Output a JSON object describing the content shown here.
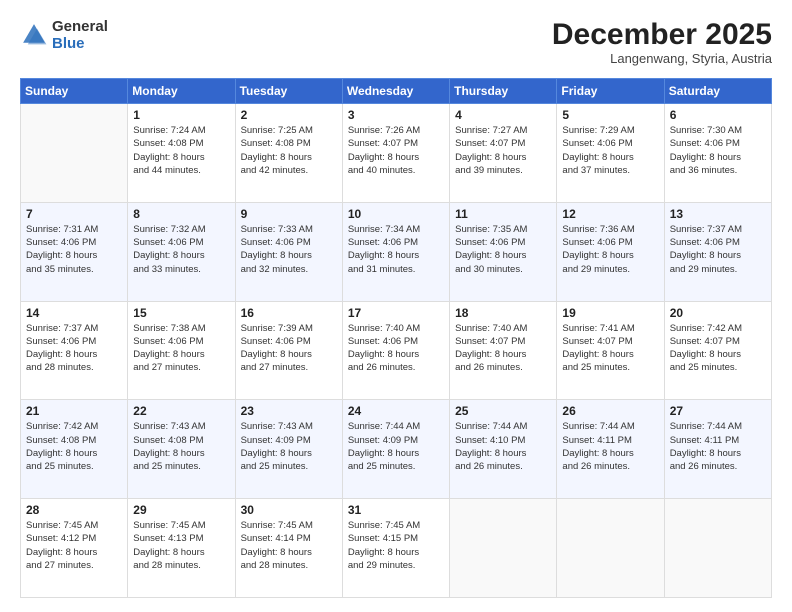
{
  "header": {
    "logo": {
      "general": "General",
      "blue": "Blue"
    },
    "title": "December 2025",
    "location": "Langenwang, Styria, Austria"
  },
  "calendar": {
    "weekdays": [
      "Sunday",
      "Monday",
      "Tuesday",
      "Wednesday",
      "Thursday",
      "Friday",
      "Saturday"
    ],
    "weeks": [
      [
        {
          "num": "",
          "info": ""
        },
        {
          "num": "1",
          "info": "Sunrise: 7:24 AM\nSunset: 4:08 PM\nDaylight: 8 hours\nand 44 minutes."
        },
        {
          "num": "2",
          "info": "Sunrise: 7:25 AM\nSunset: 4:08 PM\nDaylight: 8 hours\nand 42 minutes."
        },
        {
          "num": "3",
          "info": "Sunrise: 7:26 AM\nSunset: 4:07 PM\nDaylight: 8 hours\nand 40 minutes."
        },
        {
          "num": "4",
          "info": "Sunrise: 7:27 AM\nSunset: 4:07 PM\nDaylight: 8 hours\nand 39 minutes."
        },
        {
          "num": "5",
          "info": "Sunrise: 7:29 AM\nSunset: 4:06 PM\nDaylight: 8 hours\nand 37 minutes."
        },
        {
          "num": "6",
          "info": "Sunrise: 7:30 AM\nSunset: 4:06 PM\nDaylight: 8 hours\nand 36 minutes."
        }
      ],
      [
        {
          "num": "7",
          "info": "Sunrise: 7:31 AM\nSunset: 4:06 PM\nDaylight: 8 hours\nand 35 minutes."
        },
        {
          "num": "8",
          "info": "Sunrise: 7:32 AM\nSunset: 4:06 PM\nDaylight: 8 hours\nand 33 minutes."
        },
        {
          "num": "9",
          "info": "Sunrise: 7:33 AM\nSunset: 4:06 PM\nDaylight: 8 hours\nand 32 minutes."
        },
        {
          "num": "10",
          "info": "Sunrise: 7:34 AM\nSunset: 4:06 PM\nDaylight: 8 hours\nand 31 minutes."
        },
        {
          "num": "11",
          "info": "Sunrise: 7:35 AM\nSunset: 4:06 PM\nDaylight: 8 hours\nand 30 minutes."
        },
        {
          "num": "12",
          "info": "Sunrise: 7:36 AM\nSunset: 4:06 PM\nDaylight: 8 hours\nand 29 minutes."
        },
        {
          "num": "13",
          "info": "Sunrise: 7:37 AM\nSunset: 4:06 PM\nDaylight: 8 hours\nand 29 minutes."
        }
      ],
      [
        {
          "num": "14",
          "info": "Sunrise: 7:37 AM\nSunset: 4:06 PM\nDaylight: 8 hours\nand 28 minutes."
        },
        {
          "num": "15",
          "info": "Sunrise: 7:38 AM\nSunset: 4:06 PM\nDaylight: 8 hours\nand 27 minutes."
        },
        {
          "num": "16",
          "info": "Sunrise: 7:39 AM\nSunset: 4:06 PM\nDaylight: 8 hours\nand 27 minutes."
        },
        {
          "num": "17",
          "info": "Sunrise: 7:40 AM\nSunset: 4:06 PM\nDaylight: 8 hours\nand 26 minutes."
        },
        {
          "num": "18",
          "info": "Sunrise: 7:40 AM\nSunset: 4:07 PM\nDaylight: 8 hours\nand 26 minutes."
        },
        {
          "num": "19",
          "info": "Sunrise: 7:41 AM\nSunset: 4:07 PM\nDaylight: 8 hours\nand 25 minutes."
        },
        {
          "num": "20",
          "info": "Sunrise: 7:42 AM\nSunset: 4:07 PM\nDaylight: 8 hours\nand 25 minutes."
        }
      ],
      [
        {
          "num": "21",
          "info": "Sunrise: 7:42 AM\nSunset: 4:08 PM\nDaylight: 8 hours\nand 25 minutes."
        },
        {
          "num": "22",
          "info": "Sunrise: 7:43 AM\nSunset: 4:08 PM\nDaylight: 8 hours\nand 25 minutes."
        },
        {
          "num": "23",
          "info": "Sunrise: 7:43 AM\nSunset: 4:09 PM\nDaylight: 8 hours\nand 25 minutes."
        },
        {
          "num": "24",
          "info": "Sunrise: 7:44 AM\nSunset: 4:09 PM\nDaylight: 8 hours\nand 25 minutes."
        },
        {
          "num": "25",
          "info": "Sunrise: 7:44 AM\nSunset: 4:10 PM\nDaylight: 8 hours\nand 26 minutes."
        },
        {
          "num": "26",
          "info": "Sunrise: 7:44 AM\nSunset: 4:11 PM\nDaylight: 8 hours\nand 26 minutes."
        },
        {
          "num": "27",
          "info": "Sunrise: 7:44 AM\nSunset: 4:11 PM\nDaylight: 8 hours\nand 26 minutes."
        }
      ],
      [
        {
          "num": "28",
          "info": "Sunrise: 7:45 AM\nSunset: 4:12 PM\nDaylight: 8 hours\nand 27 minutes."
        },
        {
          "num": "29",
          "info": "Sunrise: 7:45 AM\nSunset: 4:13 PM\nDaylight: 8 hours\nand 28 minutes."
        },
        {
          "num": "30",
          "info": "Sunrise: 7:45 AM\nSunset: 4:14 PM\nDaylight: 8 hours\nand 28 minutes."
        },
        {
          "num": "31",
          "info": "Sunrise: 7:45 AM\nSunset: 4:15 PM\nDaylight: 8 hours\nand 29 minutes."
        },
        {
          "num": "",
          "info": ""
        },
        {
          "num": "",
          "info": ""
        },
        {
          "num": "",
          "info": ""
        }
      ]
    ]
  }
}
